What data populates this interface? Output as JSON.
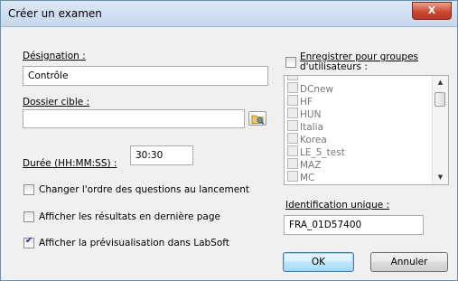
{
  "window": {
    "title": "Créer un examen",
    "close_label": "X"
  },
  "designation": {
    "label": "Désignation :",
    "value": "Contrôle"
  },
  "dossier": {
    "label": "Dossier cible :",
    "value": ""
  },
  "duree": {
    "label": "Durée (HH:MM:SS) :",
    "value": "30:30"
  },
  "options": [
    {
      "label": "Changer l'ordre des questions au lancement",
      "checked": false
    },
    {
      "label": "Afficher les résultats en dernière page",
      "checked": false
    },
    {
      "label": "Afficher la prévisualisation dans LabSoft",
      "checked": true
    }
  ],
  "groups": {
    "label_line1": "Enregistrer pour groupes",
    "label_line2": "d'utilisateurs :",
    "checked": false,
    "items": [
      "",
      "DCnew",
      "HF",
      "HUN",
      "Italia",
      "Korea",
      "LE_5_test",
      "MAZ",
      "MC"
    ]
  },
  "identification": {
    "label": "Identification unique :",
    "value": "FRA_01D57400"
  },
  "buttons": {
    "ok": "OK",
    "cancel": "Annuler"
  },
  "icons": {
    "close": "close-icon",
    "folder": "folder-browse-icon",
    "scroll_up": "chevron-up-icon",
    "scroll_down": "chevron-down-icon"
  }
}
